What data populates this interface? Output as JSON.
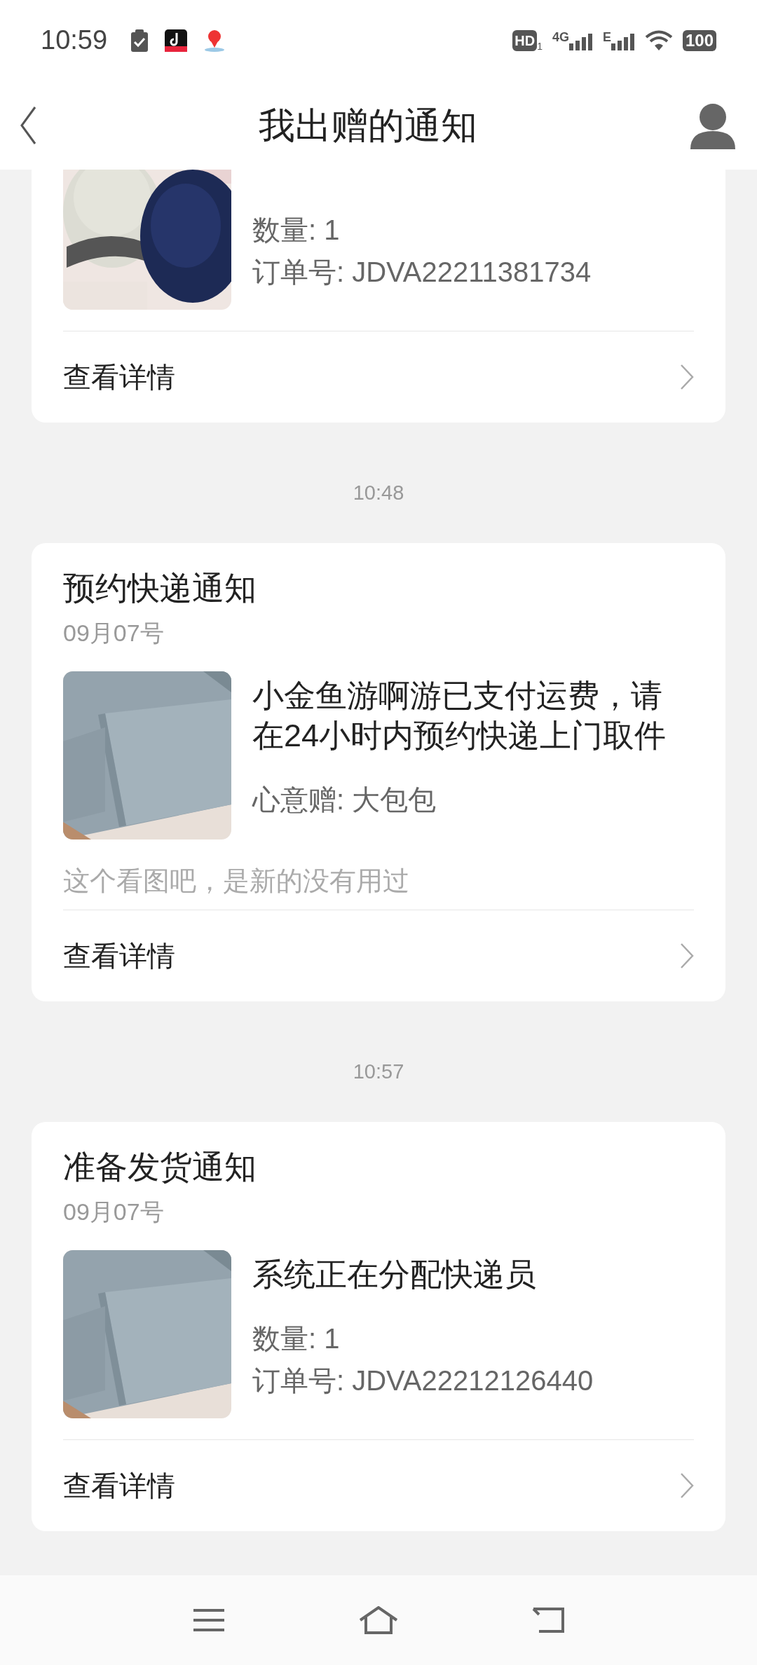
{
  "status_bar": {
    "time": "10:59",
    "hd_label": "HD",
    "hd_sub": "1",
    "network_1": "4G",
    "network_2": "E",
    "battery": "100"
  },
  "header": {
    "title": "我出赠的通知"
  },
  "notices": [
    {
      "details": [
        "数量: 1",
        "订单号: JDVA22211381734"
      ],
      "link": "查看详情"
    },
    {
      "time": "10:48",
      "title": "预约快递通知",
      "date": "09月07号",
      "message": "小金鱼游啊游已支付运费，请在24小时内预约快递上门取件",
      "details": [
        "心意赠: 大包包"
      ],
      "note": "这个看图吧，是新的没有用过",
      "link": "查看详情"
    },
    {
      "time": "10:57",
      "title": "准备发货通知",
      "date": "09月07号",
      "message": "系统正在分配快递员",
      "details": [
        "数量: 1",
        "订单号: JDVA22212126440"
      ],
      "link": "查看详情"
    }
  ]
}
